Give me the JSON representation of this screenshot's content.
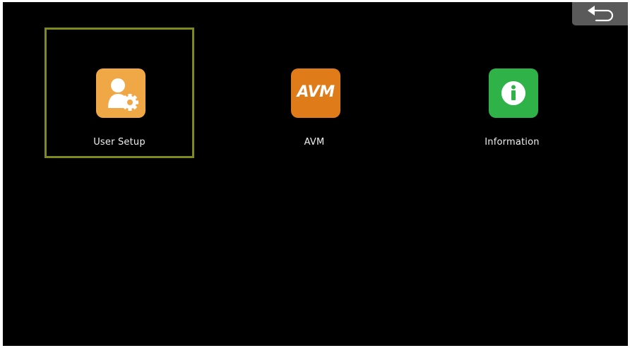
{
  "back_button": {
    "icon": "back-arrow-icon"
  },
  "menu": {
    "selected_index": 0,
    "items": [
      {
        "label": "User Setup",
        "icon": "user-settings-icon",
        "color": "#f0a745"
      },
      {
        "label": "AVM",
        "icon": "avm-icon",
        "icon_text": "AVM",
        "color": "#e07b1a"
      },
      {
        "label": "Information",
        "icon": "info-icon",
        "color": "#2fb247"
      }
    ]
  },
  "colors": {
    "background": "#000000",
    "selection_border": "#7e8a1e",
    "back_button_bg": "#5a5a5a"
  }
}
